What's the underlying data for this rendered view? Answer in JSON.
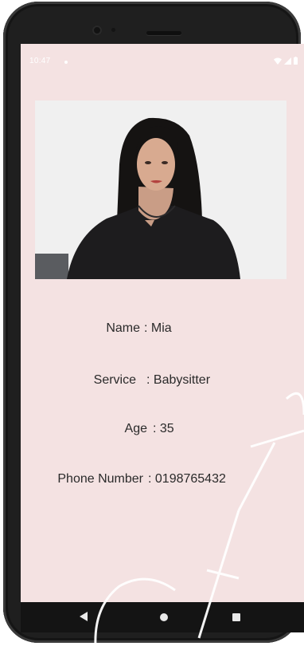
{
  "status_bar": {
    "time": "10:47",
    "icons": [
      "notification-dot-icon",
      "wifi-icon",
      "signal-icon",
      "battery-icon"
    ]
  },
  "profile": {
    "photo": "profile-photo",
    "fields": [
      {
        "label": "Name",
        "value": ": Mia"
      },
      {
        "label": "Service",
        "value": ": Babysitter"
      },
      {
        "label": "Age",
        "value": ": 35"
      },
      {
        "label": "Phone Number",
        "value": ": 0198765432"
      }
    ]
  },
  "navigation_bar": {
    "icons": [
      "back-icon",
      "home-icon",
      "recents-icon"
    ]
  },
  "colors": {
    "screen_background": "#f4e2e2",
    "device_frame": "#1f1f1f",
    "nav_bar": "#141414",
    "text": "#2a2a2a"
  }
}
